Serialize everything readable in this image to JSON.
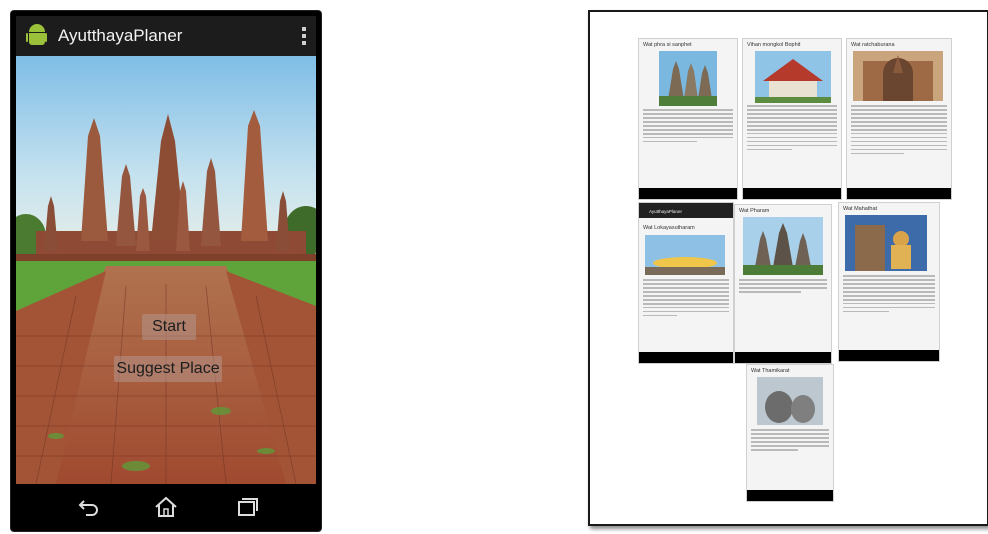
{
  "phone": {
    "app_title": "AyutthayaPlaner",
    "buttons": {
      "start": "Start",
      "suggest": "Suggest Place"
    },
    "nav": {
      "back": "back-icon",
      "home": "home-icon",
      "recents": "recents-icon"
    }
  },
  "collage": {
    "screens": [
      {
        "title": "Wat phra si sanphet"
      },
      {
        "title": "Vihan mongkol Bophit"
      },
      {
        "title": "Wat ratchaburana"
      },
      {
        "app_bar": "AyutthayaPlaner",
        "title": "Wat Lokayasutharam"
      },
      {
        "title": "Wat Pharam"
      },
      {
        "title": "Wat Mahathat"
      },
      {
        "title": "Wat Thamikarat"
      }
    ]
  },
  "colors": {
    "sky": "#8cc3e3",
    "brick": "#b8674a",
    "grass": "#5ea43a",
    "appbar": "#1c1c1c",
    "android_green": "#9bc13b"
  }
}
